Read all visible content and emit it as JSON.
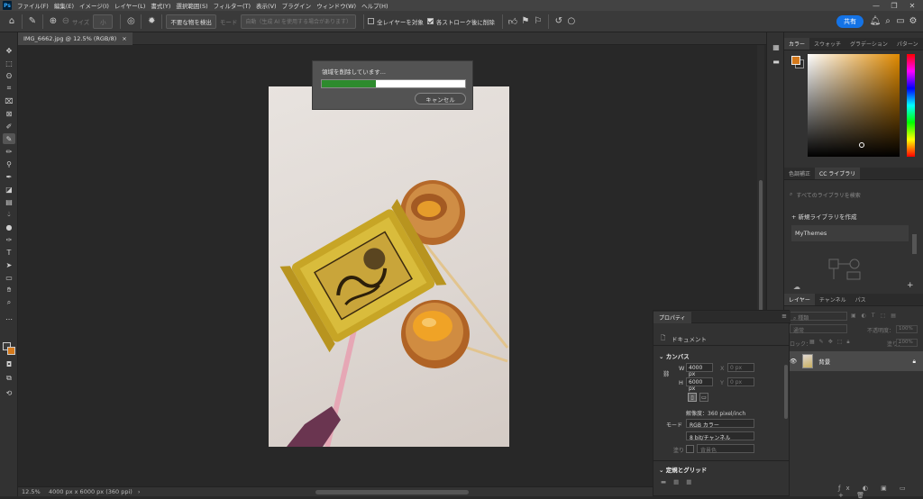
{
  "menubar": {
    "logo": "Ps",
    "items": [
      "ファイル(F)",
      "編集(E)",
      "イメージ(I)",
      "レイヤー(L)",
      "書式(Y)",
      "選択範囲(S)",
      "フィルター(T)",
      "表示(V)",
      "プラグイン",
      "ウィンドウ(W)",
      "ヘルプ(H)"
    ],
    "window_controls": [
      "—",
      "❐",
      "✕"
    ]
  },
  "options_bar": {
    "size_label": "サイズ",
    "size_value": "小",
    "remove_button": "不要な物を検出",
    "mode_label": "モード",
    "mode_value": "自動（生成 AI を使用する場合があります）",
    "sample_all_layers": "全レイヤーを対象",
    "remove_after_stroke": "各ストローク後に削除",
    "share_button": "共有"
  },
  "document": {
    "tab_title": "IMG_6662.jpg @ 12.5% (RGB/8)",
    "close": "×"
  },
  "status": {
    "zoom": "12.5%",
    "info": "4000 px x 6000 px (360 ppi)"
  },
  "progress_dialog": {
    "message": "領域を削除しています...",
    "progress": 0.38,
    "cancel_label": "キャンセル"
  },
  "color_panel": {
    "tabs": [
      "カラー",
      "スウォッチ",
      "グラデーション",
      "パターン"
    ],
    "foreground": "#d4791c",
    "background": "#2a2a2a"
  },
  "library_panel": {
    "tabs": [
      "色調補正",
      "CC ライブラリ"
    ],
    "search_placeholder": "すべてのライブラリを検索",
    "new_library": "新規ライブラリを作成",
    "library_item": "MyThemes"
  },
  "layers_panel": {
    "tabs": [
      "レイヤー",
      "チャンネル",
      "パス"
    ],
    "kind_label": "種類",
    "blend_mode": "通常",
    "opacity_label": "不透明度：",
    "opacity_value": "100%",
    "lock_label": "ロック：",
    "fill_label": "塗り：",
    "fill_value": "100%",
    "layer_name": "背景"
  },
  "properties_panel": {
    "tab": "プロパティ",
    "doc_label": "ドキュメント",
    "canvas_section": "カンバス",
    "w_label": "W",
    "w_value": "4000 px",
    "h_label": "H",
    "h_value": "6000 px",
    "x_label": "X",
    "x_value": "0 px",
    "y_label": "Y",
    "y_value": "0 px",
    "resolution": "解像度：360 pixel/inch",
    "mode_label": "モード",
    "mode_value": "RGB カラー",
    "depth_value": "8 bit/チャンネル",
    "fill_label": "塗り",
    "fill_value": "背景色",
    "grid_section": "定規とグリッド"
  }
}
